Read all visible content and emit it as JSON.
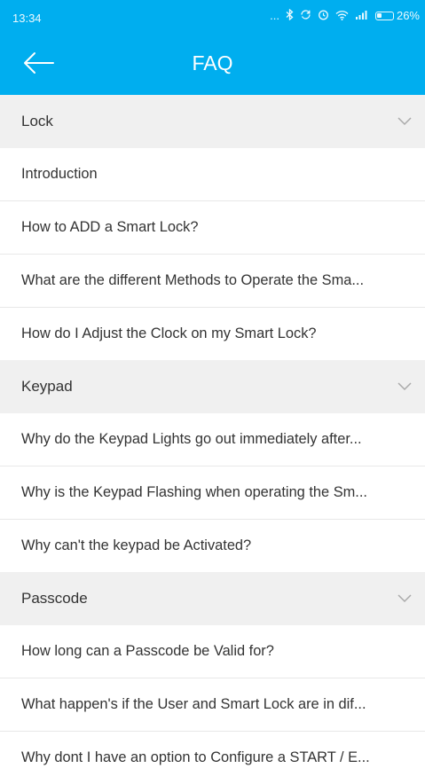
{
  "status_bar": {
    "time": "13:34",
    "dots": "...",
    "battery_percent": "26%",
    "icons": [
      "bluetooth-icon",
      "sync-icon",
      "alarm-icon",
      "wifi-icon",
      "signal-icon",
      "battery-icon"
    ]
  },
  "header": {
    "title": "FAQ",
    "back_icon": "arrow-left-icon",
    "background_color": "#00aeef"
  },
  "sections": [
    {
      "title": "Lock",
      "expand_icon": "chevron-down-icon",
      "items": [
        "Introduction",
        "How to ADD a Smart Lock?",
        "What are the different Methods to Operate the Sma...",
        "How do I Adjust the Clock on my Smart Lock?"
      ]
    },
    {
      "title": "Keypad",
      "expand_icon": "chevron-down-icon",
      "items": [
        "Why do the Keypad Lights go out immediately after...",
        "Why is the Keypad Flashing when operating the Sm...",
        "Why can't the keypad be Activated?"
      ]
    },
    {
      "title": "Passcode",
      "expand_icon": "chevron-down-icon",
      "items": [
        "How long can a Passcode be Valid for?",
        "What happen's if the User and Smart Lock are in dif...",
        "Why dont I have an option to Configure a START / E..."
      ]
    }
  ]
}
